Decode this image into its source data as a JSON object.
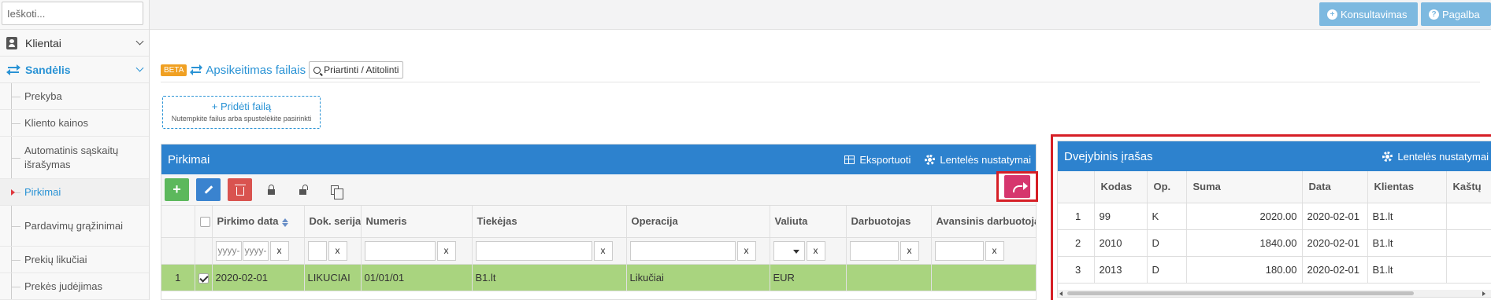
{
  "sidebar": {
    "search_placeholder": "Ieškoti...",
    "items": [
      {
        "label": "Klientai"
      },
      {
        "label": "Sandėlis"
      }
    ],
    "sub_items": [
      {
        "label": "Prekyba"
      },
      {
        "label": "Kliento kainos"
      },
      {
        "label": "Automatinis sąskaitų išrašymas"
      },
      {
        "label": "Pirkimai"
      },
      {
        "label": "Pardavimų grąžinimai"
      },
      {
        "label": "Prekių likučiai"
      },
      {
        "label": "Prekės judėjimas"
      }
    ]
  },
  "topbar": {
    "consult_label": "Konsultavimas",
    "help_label": "Pagalba"
  },
  "header": {
    "beta": "BETA",
    "title": "Apsikeitimas failais",
    "zoom_label": "Priartinti / Atitolinti"
  },
  "dropzone": {
    "title": "Pridėti failą",
    "hint": "Nutempkite failus arba spustelėkite pasirinkti"
  },
  "pirkimai": {
    "title": "Pirkimai",
    "export_label": "Eksportuoti",
    "settings_label": "Lentelės nustatymai",
    "columns": [
      "Pirkimo data",
      "Dok. serija",
      "Numeris",
      "Tiekėjas",
      "Operacija",
      "Valiuta",
      "Darbuotojas",
      "Avansinis darbuotojas"
    ],
    "filter_date_placeholder": "yyyy-",
    "filter_clear": "x",
    "rows": [
      {
        "index": "1",
        "checked": true,
        "date": "2020-02-01",
        "series": "LIKUCIAI",
        "number": "01/01/01",
        "supplier": "B1.lt",
        "operation": "Likučiai",
        "currency": "EUR",
        "employee": "",
        "advance": ""
      }
    ]
  },
  "double_entry": {
    "title": "Dvejybinis įrašas",
    "settings_label": "Lentelės nustatymai",
    "columns": [
      "",
      "Kodas",
      "Op.",
      "Suma",
      "Data",
      "Klientas",
      "Kaštų"
    ],
    "rows": [
      {
        "index": "1",
        "code": "99",
        "op": "K",
        "amount": "2020.00",
        "date": "2020-02-01",
        "client": "B1.lt"
      },
      {
        "index": "2",
        "code": "2010",
        "op": "D",
        "amount": "1840.00",
        "date": "2020-02-01",
        "client": "B1.lt"
      },
      {
        "index": "3",
        "code": "2013",
        "op": "D",
        "amount": "180.00",
        "date": "2020-02-01",
        "client": "B1.lt"
      }
    ]
  },
  "colors": {
    "accent": "#2d82ce",
    "highlight_row": "#a9d47f",
    "annotation_red": "#d61f26",
    "share_button": "#d6366e"
  }
}
